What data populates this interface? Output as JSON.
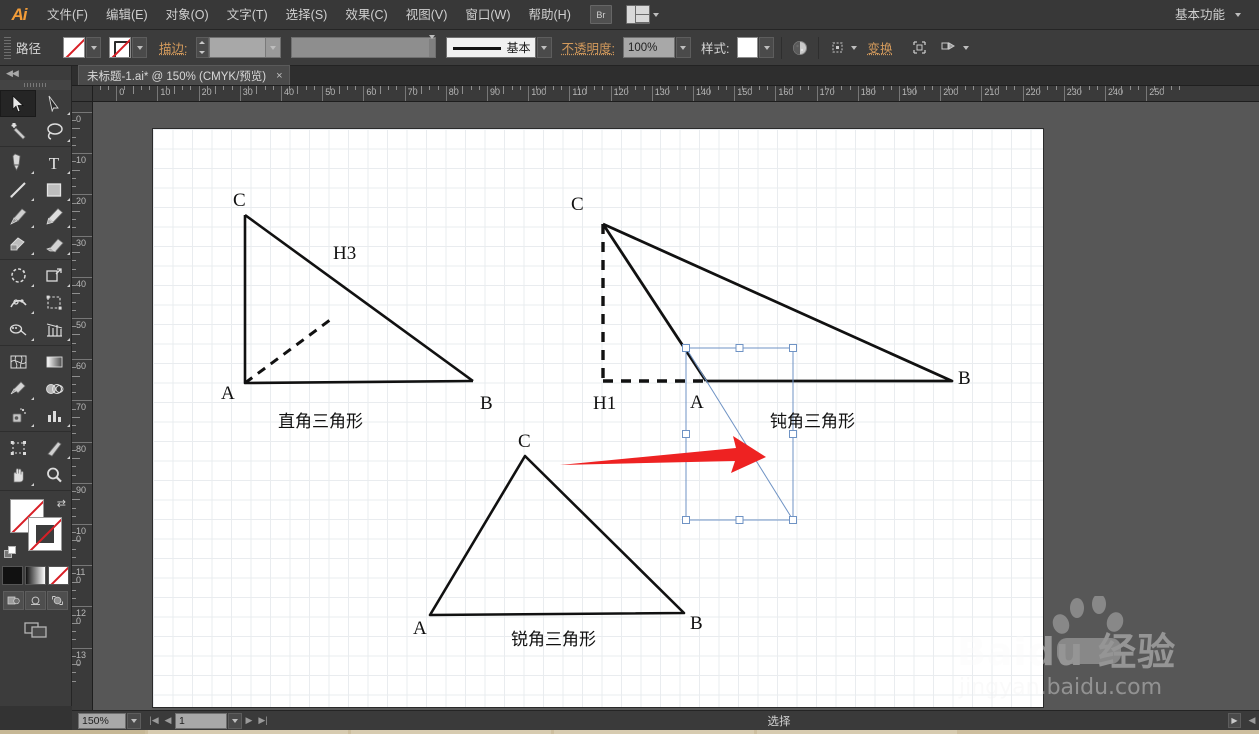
{
  "app": {
    "name": "Adobe Illustrator",
    "logo": "Ai",
    "workspace": "基本功能"
  },
  "menubar": {
    "items": [
      {
        "label": "文件(F)",
        "name": "menu-file"
      },
      {
        "label": "编辑(E)",
        "name": "menu-edit"
      },
      {
        "label": "对象(O)",
        "name": "menu-object"
      },
      {
        "label": "文字(T)",
        "name": "menu-type"
      },
      {
        "label": "选择(S)",
        "name": "menu-select"
      },
      {
        "label": "效果(C)",
        "name": "menu-effect"
      },
      {
        "label": "视图(V)",
        "name": "menu-view"
      },
      {
        "label": "窗口(W)",
        "name": "menu-window"
      },
      {
        "label": "帮助(H)",
        "name": "menu-help"
      }
    ],
    "bridge_label": "Br"
  },
  "controlbar": {
    "selection_type": "路径",
    "stroke_label": "描边:",
    "stroke_weight": "",
    "stroke_profile": "基本",
    "opacity_label": "不透明度:",
    "opacity_value": "100%",
    "style_label": "样式:",
    "transform_label": "变换"
  },
  "document": {
    "tab_title": "未标题-1.ai* @ 150% (CMYK/预览)",
    "close_label": "×"
  },
  "rulers": {
    "horizontal": [
      "10",
      "0",
      "10",
      "20",
      "30",
      "40",
      "50",
      "60",
      "70",
      "80",
      "90",
      "100",
      "110",
      "120",
      "130",
      "140",
      "150",
      "160",
      "170",
      "180",
      "190",
      "200",
      "210",
      "220",
      "230",
      "240",
      "250"
    ],
    "vertical": [
      "0",
      "10",
      "20",
      "30",
      "40",
      "50",
      "60",
      "70",
      "80",
      "90",
      "100",
      "110",
      "120",
      "130"
    ]
  },
  "artwork": {
    "triangles": [
      {
        "name": "right-triangle",
        "caption": "直角三角形",
        "vertex_labels": [
          "C",
          "A",
          "B"
        ],
        "altitude_label": "H3"
      },
      {
        "name": "obtuse-triangle",
        "caption": "钝角三角形",
        "vertex_labels": [
          "C",
          "A",
          "B"
        ],
        "altitude_label": "H1"
      },
      {
        "name": "acute-triangle",
        "caption": "锐角三角形",
        "vertex_labels": [
          "C",
          "A",
          "B"
        ],
        "altitude_label": ""
      }
    ],
    "annotation": {
      "arrow_color": "#ee2222",
      "selection_color": "#6f93c4"
    }
  },
  "statusbar": {
    "zoom": "150%",
    "page": "1",
    "status_text": "选择"
  },
  "watermark": {
    "brand": "Baidu 经验",
    "url": "jingyan.baidu.com"
  },
  "colors": {
    "chrome": "#3c3c3c",
    "menubar": "#383838",
    "canvas_bg": "#575757",
    "artboard": "#ffffff",
    "accent_orange": "#d39a5c",
    "logo_orange": "#f29c38"
  }
}
